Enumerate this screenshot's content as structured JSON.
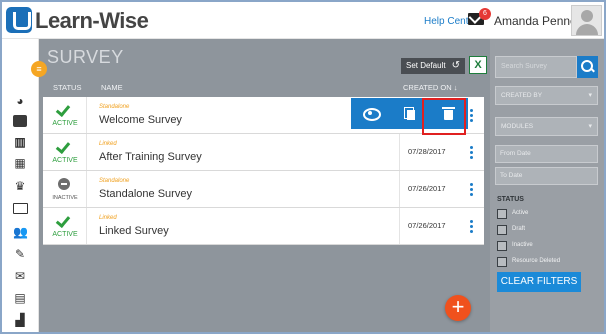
{
  "header": {
    "app_name": "Learn-Wise",
    "help_center": "Help Center",
    "mail_count": "6",
    "user_name": "Amanda Pennell"
  },
  "sidebar": {
    "icons": [
      "dashboard-icon",
      "library-icon",
      "courses-icon",
      "calendar-icon",
      "trophy-icon",
      "presentation-icon",
      "users-icon",
      "assign-icon",
      "mail-icon",
      "certificate-icon",
      "reports-icon"
    ]
  },
  "main": {
    "title": "SURVEY",
    "set_default_label": "Set Default",
    "undo_glyph": "↺",
    "excel_glyph": "X",
    "columns": {
      "status": "STATUS",
      "name": "NAME",
      "created_on": "CREATED ON ↓"
    },
    "rows": [
      {
        "status": "ACTIVE",
        "type": "Standalone",
        "name": "Welcome Survey",
        "date": ""
      },
      {
        "status": "ACTIVE",
        "type": "Linked",
        "name": "After Training Survey",
        "date": "07/28/2017"
      },
      {
        "status": "INACTIVE",
        "type": "Standalone",
        "name": "Standalone Survey",
        "date": "07/26/2017"
      },
      {
        "status": "ACTIVE",
        "type": "Linked",
        "name": "Linked Survey",
        "date": "07/26/2017"
      }
    ],
    "fab_glyph": "+"
  },
  "filters": {
    "search_placeholder": "Search Survey",
    "created_by": "CREATED BY",
    "modules": "MODULES",
    "from_date": "From Date",
    "to_date": "To Date",
    "status_heading": "STATUS",
    "status_options": [
      "Active",
      "Draft",
      "Inactive",
      "Resource Deleted"
    ],
    "clear_label": "CLEAR FILTERS"
  },
  "colors": {
    "accent": "#1b7cc8",
    "active": "#2e9e3e",
    "type_label": "#f0a01e",
    "fab": "#f0511d",
    "highlight": "#e02020"
  }
}
